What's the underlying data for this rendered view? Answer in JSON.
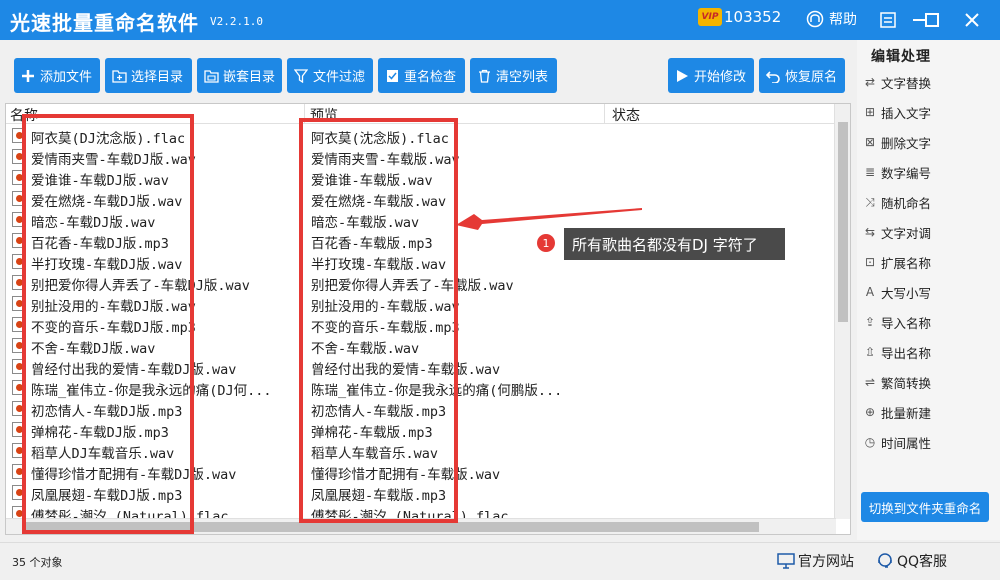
{
  "app": {
    "title": "光速批量重命名软件",
    "version": "V2.2.1.0",
    "vip_label": "VIP",
    "vip_id": "103352",
    "help": "帮助"
  },
  "toolbar": {
    "add_file": "添加文件",
    "select_dir": "选择目录",
    "nested_dir": "嵌套目录",
    "filter": "文件过滤",
    "rename_check": "重名检查",
    "clear_list": "清空列表",
    "start": "开始修改",
    "restore": "恢复原名"
  },
  "list": {
    "col_name": "名称",
    "col_preview": "预览",
    "col_status": "状态",
    "rows": [
      {
        "name": "阿衣莫(DJ沈念版).flac",
        "preview": "阿衣莫(沈念版).flac"
      },
      {
        "name": "爱情雨夹雪-车载DJ版.wav",
        "preview": "爱情雨夹雪-车载版.wav"
      },
      {
        "name": "爱谁谁-车载DJ版.wav",
        "preview": "爱谁谁-车载版.wav"
      },
      {
        "name": "爱在燃烧-车载DJ版.wav",
        "preview": "爱在燃烧-车载版.wav"
      },
      {
        "name": "暗恋-车载DJ版.wav",
        "preview": "暗恋-车载版.wav"
      },
      {
        "name": "百花香-车载DJ版.mp3",
        "preview": "百花香-车载版.mp3"
      },
      {
        "name": "半打玫瑰-车载DJ版.wav",
        "preview": "半打玫瑰-车载版.wav"
      },
      {
        "name": "别把爱你得人弄丢了-车载DJ版.wav",
        "preview": "别把爱你得人弄丢了-车载版.wav"
      },
      {
        "name": "别扯没用的-车载DJ版.wav",
        "preview": "别扯没用的-车载版.wav"
      },
      {
        "name": "不变的音乐-车载DJ版.mp3",
        "preview": "不变的音乐-车载版.mp3"
      },
      {
        "name": "不舍-车载DJ版.wav",
        "preview": "不舍-车载版.wav"
      },
      {
        "name": "曾经付出我的爱情-车载DJ版.wav",
        "preview": "曾经付出我的爱情-车载版.wav"
      },
      {
        "name": "陈瑞_崔伟立-你是我永远的痛(DJ何...",
        "preview": "陈瑞_崔伟立-你是我永远的痛(何鹏版..."
      },
      {
        "name": "初恋情人-车载DJ版.mp3",
        "preview": "初恋情人-车载版.mp3"
      },
      {
        "name": "弹棉花-车载DJ版.mp3",
        "preview": "弹棉花-车载版.mp3"
      },
      {
        "name": "稻草人DJ车载音乐.wav",
        "preview": "稻草人车载音乐.wav"
      },
      {
        "name": "懂得珍惜才配拥有-车载DJ版.wav",
        "preview": "懂得珍惜才配拥有-车载版.wav"
      },
      {
        "name": "凤凰展翅-车载DJ版.mp3",
        "preview": "凤凰展翅-车载版.mp3"
      },
      {
        "name": "傅梦彤-潮汐 (Natural).flac",
        "preview": "傅梦彤-潮汐 (Natural).flac"
      }
    ]
  },
  "callout": {
    "number": "1",
    "text": "所有歌曲名都没有DJ 字符了"
  },
  "panel": {
    "title": "编辑处理",
    "items": [
      "文字替换",
      "插入文字",
      "删除文字",
      "数字编号",
      "随机命名",
      "文字对调",
      "扩展名称",
      "大写小写",
      "导入名称",
      "导出名称",
      "繁简转换",
      "批量新建",
      "时间属性"
    ],
    "switch": "切换到文件夹重命名"
  },
  "status": {
    "count": "35 个对象",
    "site": "官方网站",
    "qq": "QQ客服"
  },
  "colors": {
    "primary": "#1e88e5",
    "highlight": "#e53935",
    "callout_bg": "#4a4a4a"
  }
}
